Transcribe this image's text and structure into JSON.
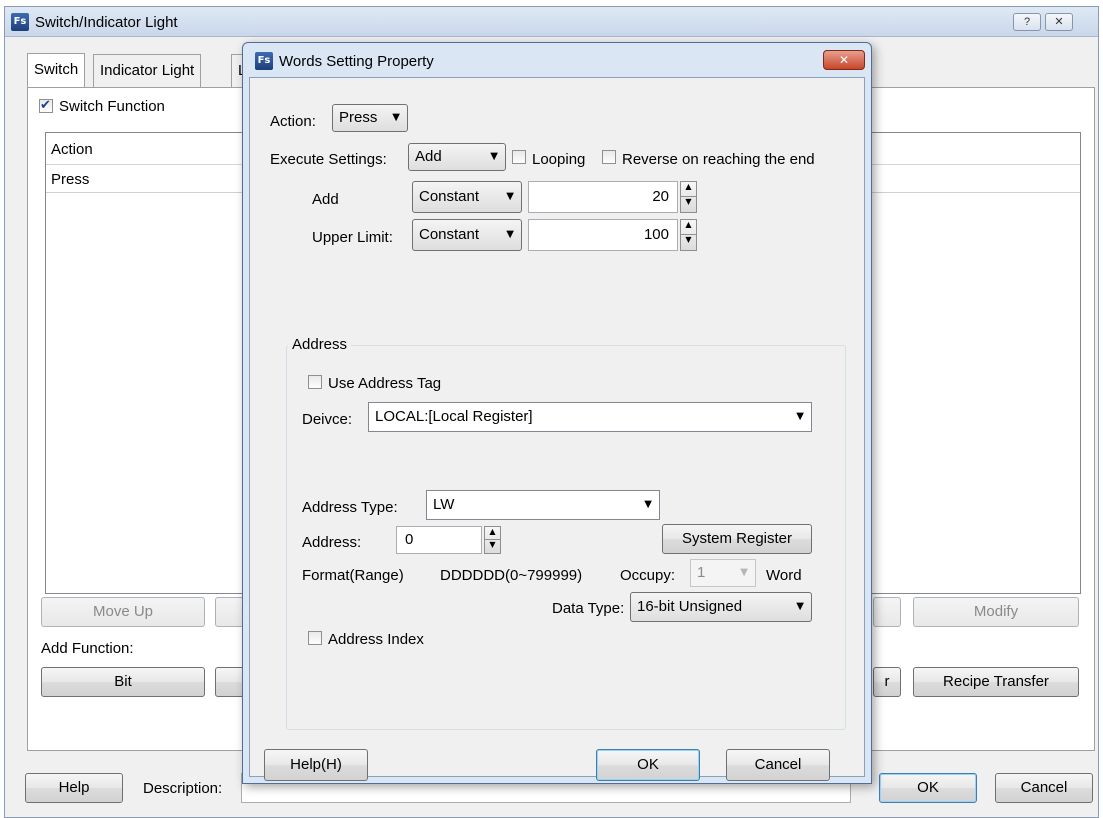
{
  "outer": {
    "title": "Switch/Indicator Light",
    "icon_text": "Fs",
    "help_caption": "?",
    "close_caption": "✕",
    "tabs": [
      "Switch",
      "Indicator Light",
      "L"
    ],
    "switch_function_label": "Switch Function",
    "switch_function_checked": true,
    "list": {
      "column": "Action",
      "rows": [
        "Press"
      ]
    },
    "buttons": {
      "move_up": "Move Up",
      "modify": "Modify"
    },
    "add_function_label": "Add Function:",
    "function_buttons": {
      "bit": "Bit",
      "recipe_transfer": "Recipe Transfer",
      "partial": "r"
    },
    "help": "Help",
    "description_label": "Description:",
    "ok": "OK",
    "cancel": "Cancel"
  },
  "dialog": {
    "title": "Words Setting Property",
    "icon_text": "Fs",
    "close_glyph": "✕",
    "action_label": "Action:",
    "action_value": "Press",
    "execute_label": "Execute Settings:",
    "execute_value": "Add",
    "looping_label": "Looping",
    "reverse_label": "Reverse on reaching the end",
    "add_row": {
      "label": "Add",
      "mode": "Constant",
      "value": "20"
    },
    "upper_row": {
      "label": "Upper Limit:",
      "mode": "Constant",
      "value": "100"
    },
    "address": {
      "group_title": "Address",
      "use_tag_label": "Use Address Tag",
      "device_label": "Deivce:",
      "device_value": "LOCAL:[Local Register]",
      "type_label": "Address Type:",
      "type_value": "LW",
      "address_label": "Address:",
      "address_value": "0",
      "system_register": "System Register",
      "format_label": "Format(Range)",
      "format_value": "DDDDDD(0~799999)",
      "occupy_label": "Occupy:",
      "occupy_value": "1",
      "occupy_unit": "Word",
      "data_type_label": "Data Type:",
      "data_type_value": "16-bit Unsigned",
      "index_label": "Address Index"
    },
    "help_button": "Help(H)",
    "ok_button": "OK",
    "cancel_button": "Cancel"
  }
}
